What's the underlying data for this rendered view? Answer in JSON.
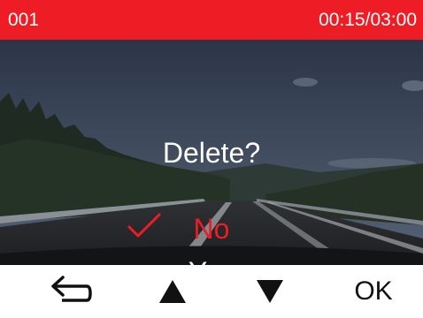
{
  "status_bar": {
    "file_number": "001",
    "playback_time": "00:15/03:00",
    "color": "#ee1c25"
  },
  "dialog": {
    "title": "Delete?",
    "options": [
      {
        "label": "No",
        "selected": true
      },
      {
        "label": "Yes",
        "selected": false
      }
    ],
    "selected_color": "#ee1c25"
  },
  "softkeys": {
    "back_icon": "back-arrow-icon",
    "up_icon": "triangle-up-icon",
    "down_icon": "triangle-down-icon",
    "ok_label": "OK"
  }
}
